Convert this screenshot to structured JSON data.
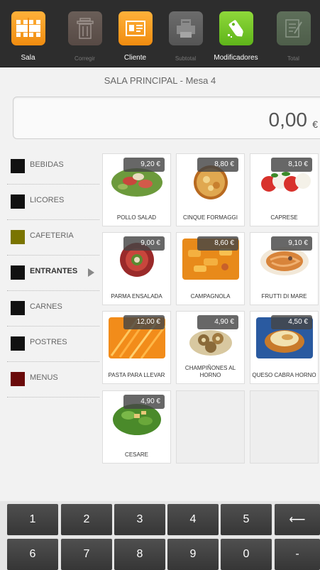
{
  "toolbar": {
    "items": [
      {
        "label": "Sala",
        "icon": "tables-icon",
        "state": "active"
      },
      {
        "label": "Corregir",
        "icon": "trash-icon",
        "state": "disabled"
      },
      {
        "label": "Cliente",
        "icon": "client-card-icon",
        "state": "active"
      },
      {
        "label": "Subtotal",
        "icon": "printer-icon",
        "state": "disabled"
      },
      {
        "label": "Modificadores",
        "icon": "edit-tag-icon",
        "state": "active"
      },
      {
        "label": "Total",
        "icon": "total-edit-icon",
        "state": "disabled"
      }
    ]
  },
  "header": {
    "title": "SALA PRINCIPAL  -  Mesa 4"
  },
  "display": {
    "amount": "0,00",
    "currency": "€"
  },
  "categories": [
    {
      "label": "BEBIDAS",
      "color": "#111111"
    },
    {
      "label": "LICORES",
      "color": "#111111"
    },
    {
      "label": "CAFETERIA",
      "color": "#7a7400"
    },
    {
      "label": "ENTRANTES",
      "color": "#111111",
      "selected": true
    },
    {
      "label": "CARNES",
      "color": "#111111"
    },
    {
      "label": "POSTRES",
      "color": "#111111"
    },
    {
      "label": "MENUS",
      "color": "#6a0a0a"
    }
  ],
  "products": [
    {
      "name": "POLLO SALAD",
      "price": "9,20 €",
      "image": "salad-photo"
    },
    {
      "name": "CINQUE FORMAGGI",
      "price": "8,80 €",
      "image": "pizza-photo"
    },
    {
      "name": "CAPRESE",
      "price": "8,10 €",
      "image": "caprese-photo"
    },
    {
      "name": "PARMA ENSALADA",
      "price": "9,00 €",
      "image": "parma-photo"
    },
    {
      "name": "CAMPAGNOLA",
      "price": "8,60 €",
      "image": "pasta-photo"
    },
    {
      "name": "FRUTTI DI MARE",
      "price": "9,10 €",
      "image": "seafood-pasta-photo"
    },
    {
      "name": "PASTA PARA LLEVAR",
      "price": "12,00 €",
      "image": "raw-pasta-photo"
    },
    {
      "name": "CHAMPIÑONES AL HORNO",
      "price": "4,90 €",
      "image": "mushrooms-photo"
    },
    {
      "name": "QUESO CABRA HORNO",
      "price": "4,50 €",
      "image": "goat-cheese-photo"
    },
    {
      "name": "CESARE",
      "price": "4,90 €",
      "image": "caesar-photo"
    }
  ],
  "keypad": {
    "keys": [
      "1",
      "2",
      "3",
      "4",
      "5",
      "⟵",
      "6",
      "7",
      "8",
      "9",
      "0",
      "-"
    ]
  }
}
